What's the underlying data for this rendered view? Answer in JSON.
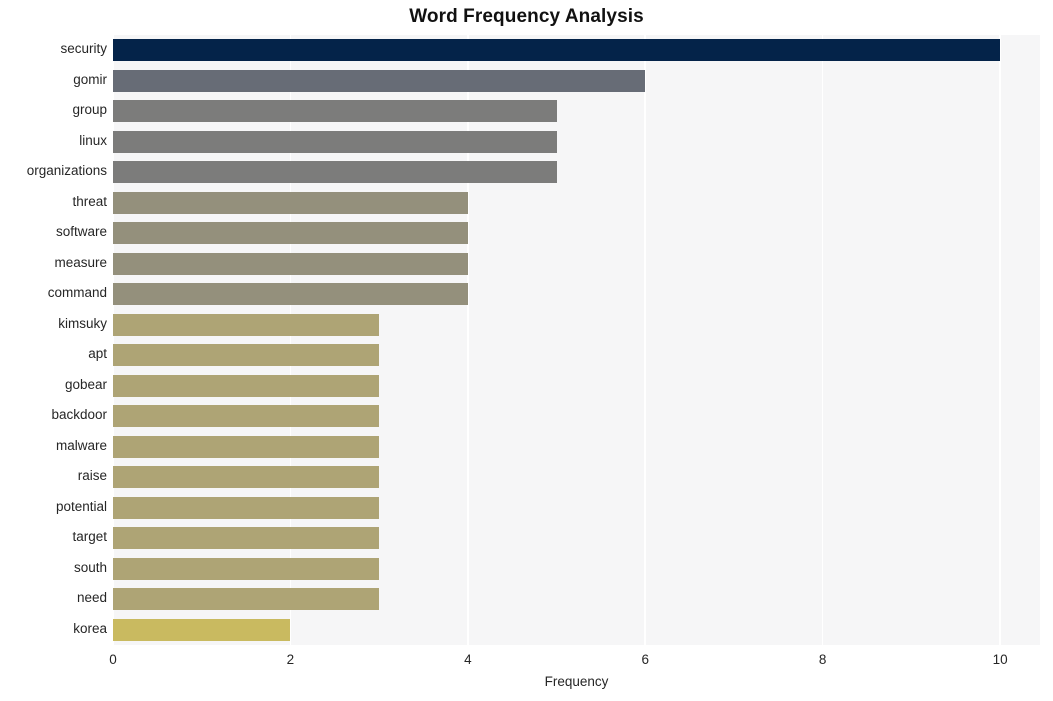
{
  "chart_data": {
    "type": "bar",
    "orientation": "horizontal",
    "title": "Word Frequency Analysis",
    "xlabel": "Frequency",
    "ylabel": "",
    "xlim": [
      0,
      10.45
    ],
    "ylim": [
      0,
      20
    ],
    "grid": "vertical-white-on-light-background",
    "legend": null,
    "xticks": [
      "0",
      "2",
      "4",
      "6",
      "8",
      "10"
    ],
    "xtick_values": [
      0,
      2,
      4,
      6,
      8,
      10
    ],
    "categories": [
      "security",
      "gomir",
      "group",
      "linux",
      "organizations",
      "threat",
      "software",
      "measure",
      "command",
      "kimsuky",
      "apt",
      "gobear",
      "backdoor",
      "malware",
      "raise",
      "potential",
      "target",
      "south",
      "need",
      "korea"
    ],
    "values": [
      10,
      6,
      5,
      5,
      5,
      4,
      4,
      4,
      4,
      3,
      3,
      3,
      3,
      3,
      3,
      3,
      3,
      3,
      3,
      2
    ],
    "bar_colors": [
      "#042349",
      "#676c76",
      "#7c7c7b",
      "#7c7c7b",
      "#7c7c7b",
      "#94907c",
      "#94907c",
      "#94907c",
      "#94907c",
      "#aea475",
      "#aea475",
      "#aea475",
      "#aea475",
      "#aea475",
      "#aea475",
      "#aea475",
      "#aea475",
      "#aea475",
      "#aea475",
      "#c9ba60"
    ]
  },
  "style": {
    "figure_background": "#ffffff",
    "plot_background": "#f6f6f7",
    "gridline_color": "#ffffff",
    "text_color": "#262626",
    "title_color": "#111111"
  }
}
